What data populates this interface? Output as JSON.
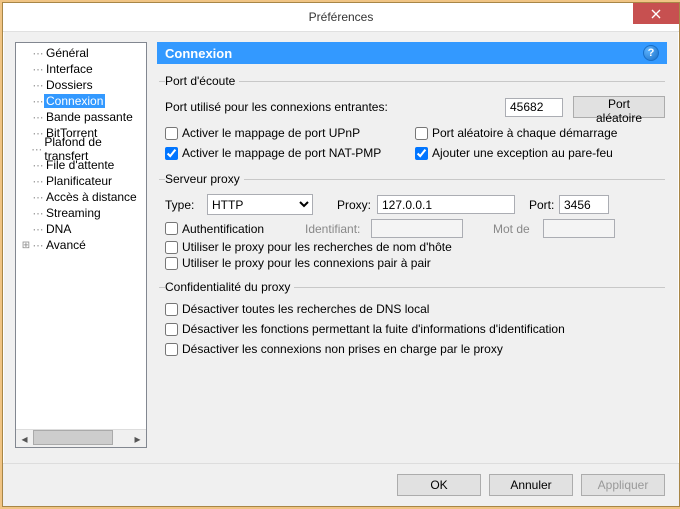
{
  "title": "Préférences",
  "sidebar": {
    "items": [
      {
        "label": "Général",
        "expander": "",
        "selected": false
      },
      {
        "label": "Interface",
        "expander": "",
        "selected": false
      },
      {
        "label": "Dossiers",
        "expander": "",
        "selected": false
      },
      {
        "label": "Connexion",
        "expander": "",
        "selected": true
      },
      {
        "label": "Bande passante",
        "expander": "",
        "selected": false
      },
      {
        "label": "BitTorrent",
        "expander": "",
        "selected": false
      },
      {
        "label": "Plafond de transfert",
        "expander": "",
        "selected": false
      },
      {
        "label": "File d'attente",
        "expander": "",
        "selected": false
      },
      {
        "label": "Planificateur",
        "expander": "",
        "selected": false
      },
      {
        "label": "Accès à distance",
        "expander": "",
        "selected": false
      },
      {
        "label": "Streaming",
        "expander": "",
        "selected": false
      },
      {
        "label": "DNA",
        "expander": "",
        "selected": false
      },
      {
        "label": "Avancé",
        "expander": "+",
        "selected": false
      }
    ]
  },
  "panel": {
    "title": "Connexion",
    "help": "?",
    "listen": {
      "legend": "Port d'écoute",
      "port_label": "Port utilisé pour les connexions entrantes:",
      "port_value": "45682",
      "random_btn": "Port aléatoire",
      "upnp": {
        "checked": false,
        "label": "Activer le mappage de port UPnP"
      },
      "random_start": {
        "checked": false,
        "label": "Port aléatoire à chaque démarrage"
      },
      "natpmp": {
        "checked": true,
        "label": "Activer le mappage de port NAT-PMP"
      },
      "firewall": {
        "checked": true,
        "label": "Ajouter une exception au pare-feu"
      }
    },
    "proxy": {
      "legend": "Serveur proxy",
      "type_label": "Type:",
      "type_value": "HTTP",
      "proxy_label": "Proxy:",
      "proxy_value": "127.0.0.1",
      "port_label": "Port:",
      "port_value": "3456",
      "auth": {
        "checked": false,
        "label": "Authentification"
      },
      "user_label": "Identifiant:",
      "user_value": "",
      "pass_label": "Mot de",
      "pass_value": "",
      "hostlookup": {
        "checked": false,
        "label": "Utiliser le proxy pour les recherches de nom d'hôte"
      },
      "p2p": {
        "checked": false,
        "label": "Utiliser le proxy pour les connexions pair à pair"
      }
    },
    "privacy": {
      "legend": "Confidentialité du proxy",
      "dns": {
        "checked": false,
        "label": "Désactiver toutes les recherches de DNS local"
      },
      "leak": {
        "checked": false,
        "label": "Désactiver les fonctions permettant la fuite d'informations d'identification"
      },
      "unsupported": {
        "checked": false,
        "label": "Désactiver les connexions non prises en charge par le proxy"
      }
    }
  },
  "footer": {
    "ok": "OK",
    "cancel": "Annuler",
    "apply": "Appliquer"
  }
}
